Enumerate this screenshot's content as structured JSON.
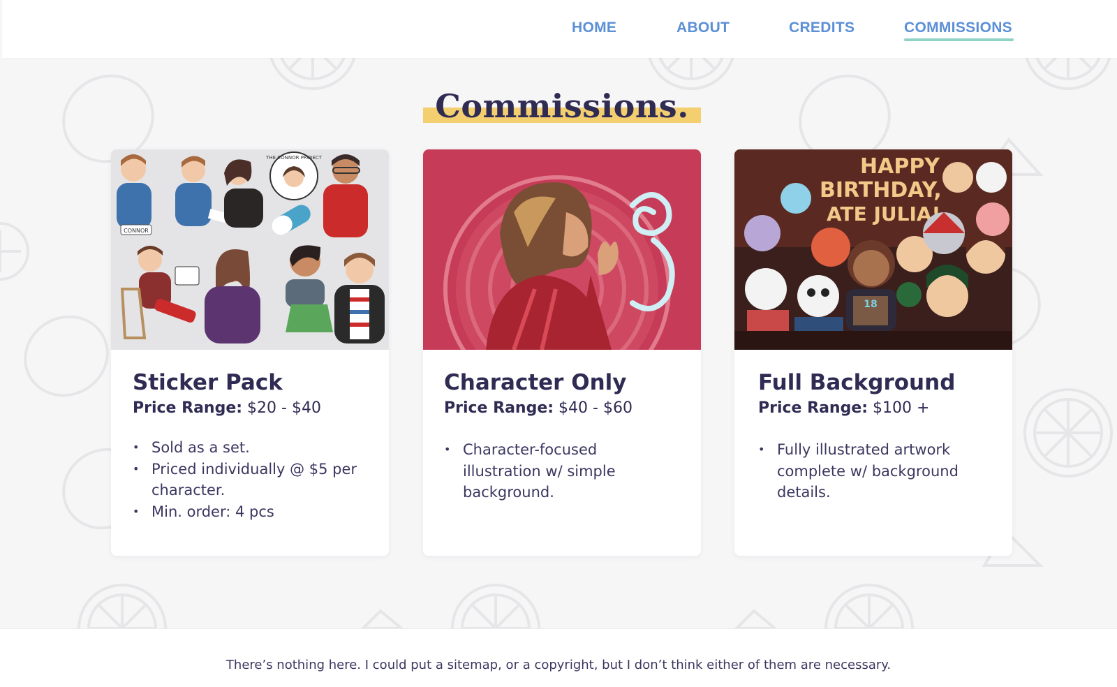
{
  "nav": {
    "links": [
      "HOME",
      "ABOUT",
      "CREDITS",
      "COMMISSIONS"
    ],
    "active": "COMMISSIONS"
  },
  "page": {
    "title": "Commissions."
  },
  "cards": [
    {
      "title": "Sticker Pack",
      "price_label": "Price Range:",
      "price_value": " $20 - $40",
      "bullets": [
        "Sold as a set.",
        "Priced individually @ $5 per character.",
        "Min. order: 4 pcs"
      ],
      "image_text": [
        "THE CONNOR PROJECT",
        "CONNOR"
      ]
    },
    {
      "title": "Character Only",
      "price_label": "Price Range:",
      "price_value": " $40 - $60",
      "bullets": [
        "Character-focused illustration w/ simple background."
      ]
    },
    {
      "title": "Full Background",
      "price_label": "Price Range:",
      "price_value": " $100 +",
      "bullets": [
        "Fully illustrated artwork complete w/ background details."
      ],
      "image_text": [
        "HAPPY",
        "BIRTHDAY,",
        "ATE JULIA!",
        "18"
      ]
    }
  ],
  "footer": {
    "text": "There’s nothing here. I could put a sitemap, or a copyright, but I don’t think either of them are necessary."
  },
  "colors": {
    "nav_link": "#5b8fd6",
    "nav_underline": "#8fd3c6",
    "title_highlight": "#f3cf6f",
    "heading": "#2f2b53",
    "background": "#f6f6f7",
    "card2_bg": "#c63b57",
    "card3_bg": "#3a1f1c"
  },
  "icons": [
    "lemon-pattern-icon"
  ]
}
